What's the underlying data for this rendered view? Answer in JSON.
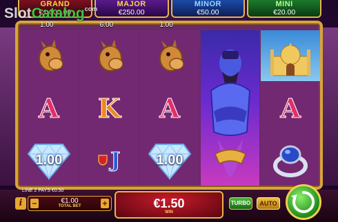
{
  "watermark": {
    "part1": "Slot",
    "part2": "Catalog",
    "suffix": "com"
  },
  "jackpots": [
    {
      "name": "GRAND",
      "value": "€1,000.00"
    },
    {
      "name": "MAJOR",
      "value": "€250.00"
    },
    {
      "name": "MINOR",
      "value": "€50.00"
    },
    {
      "name": "MINI",
      "value": "€20.00"
    }
  ],
  "reel_values": [
    "1.00",
    "6.00",
    "1.00"
  ],
  "reels": {
    "reel1": [
      "camel",
      "A",
      "1.00"
    ],
    "reel2": [
      "camel",
      "K",
      "J"
    ],
    "reel3": [
      "camel",
      "A",
      "1.00"
    ],
    "reel4": [
      "genie"
    ],
    "reel5": [
      "palace",
      "A",
      "ring"
    ]
  },
  "symbols": {
    "a": "A",
    "k": "K",
    "j": "J",
    "diamond_value": "1.00"
  },
  "bottom": {
    "line_pays": "LINE 2 PAYS €0.50",
    "info_label": "i",
    "bet_value": "€1.00",
    "bet_label": "TOTAL BET",
    "minus": "−",
    "plus": "+",
    "win_value": "€1.50",
    "win_label": "WIN",
    "turbo_label": "TURBO",
    "auto_label": "AUTO"
  },
  "colors": {
    "gold": "#d9a43a",
    "win_red": "#c81a2a",
    "spin_green": "#1e8a1a"
  },
  "icons": [
    "camel-icon",
    "genie-icon",
    "palace-icon",
    "ring-icon",
    "diamond-icon",
    "spin-icon"
  ]
}
